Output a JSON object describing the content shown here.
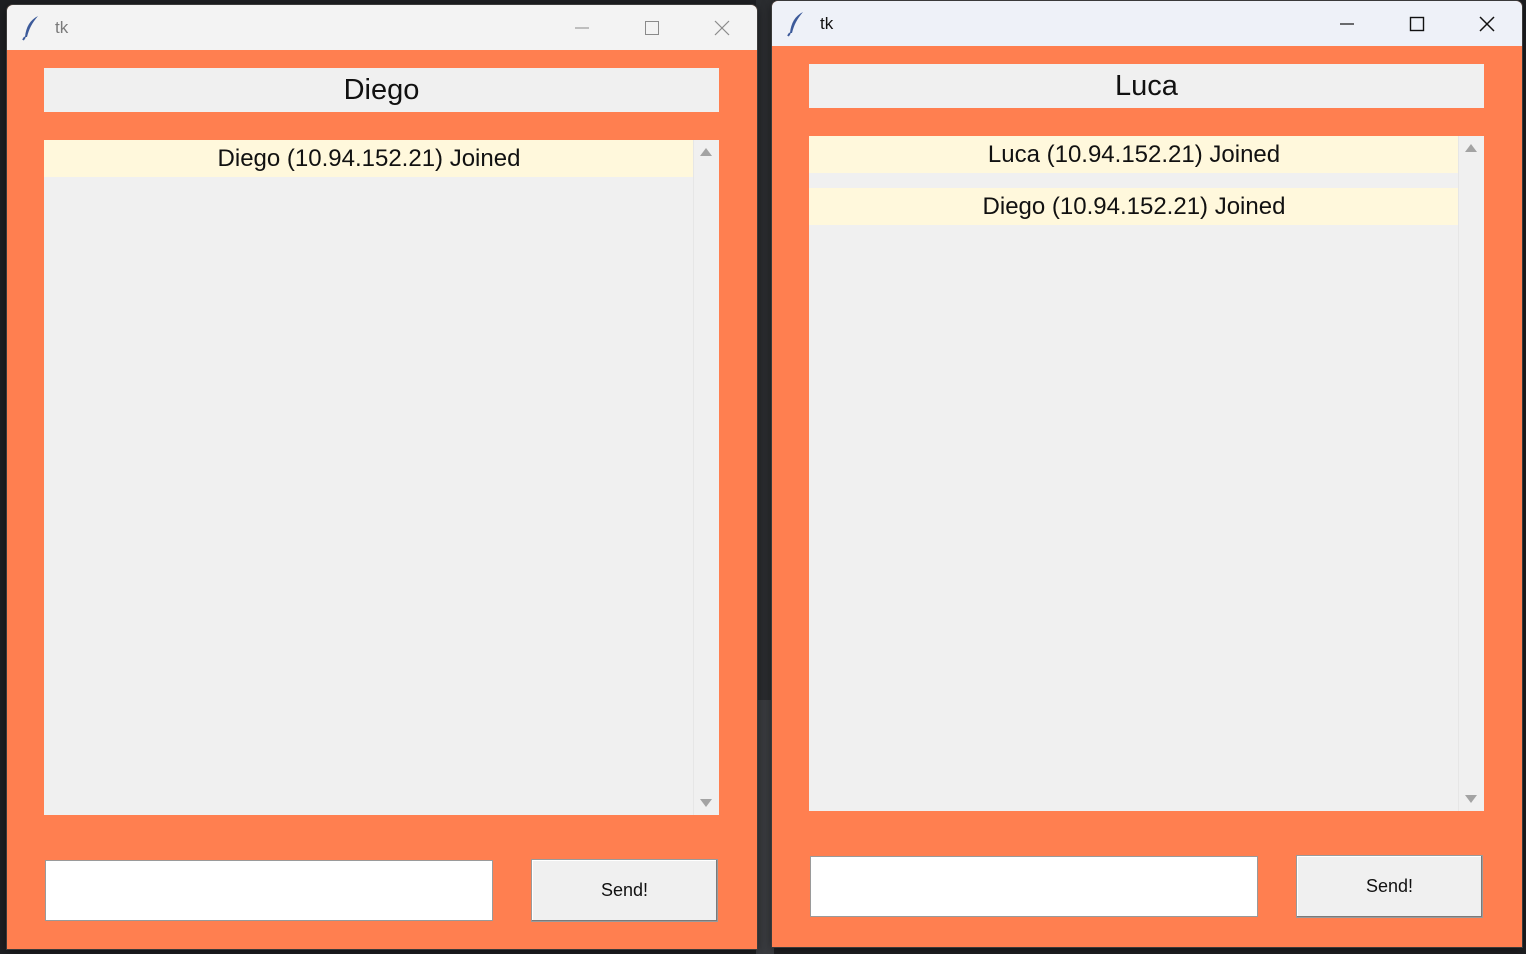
{
  "windows": [
    {
      "title": "tk",
      "name_label": "Diego",
      "messages": [
        "Diego (10.94.152.21) Joined"
      ],
      "entry_value": "",
      "send_label": "Send!"
    },
    {
      "title": "tk",
      "name_label": "Luca",
      "messages": [
        "Luca (10.94.152.21) Joined",
        "Diego (10.94.152.21) Joined"
      ],
      "entry_value": "",
      "send_label": "Send!"
    }
  ],
  "colors": {
    "window_bg": "#ff7f50",
    "message_bg": "#fff8dc",
    "widget_bg": "#f0f0f0"
  },
  "icons": [
    "feather-icon",
    "minimize-icon",
    "maximize-icon",
    "close-icon"
  ]
}
